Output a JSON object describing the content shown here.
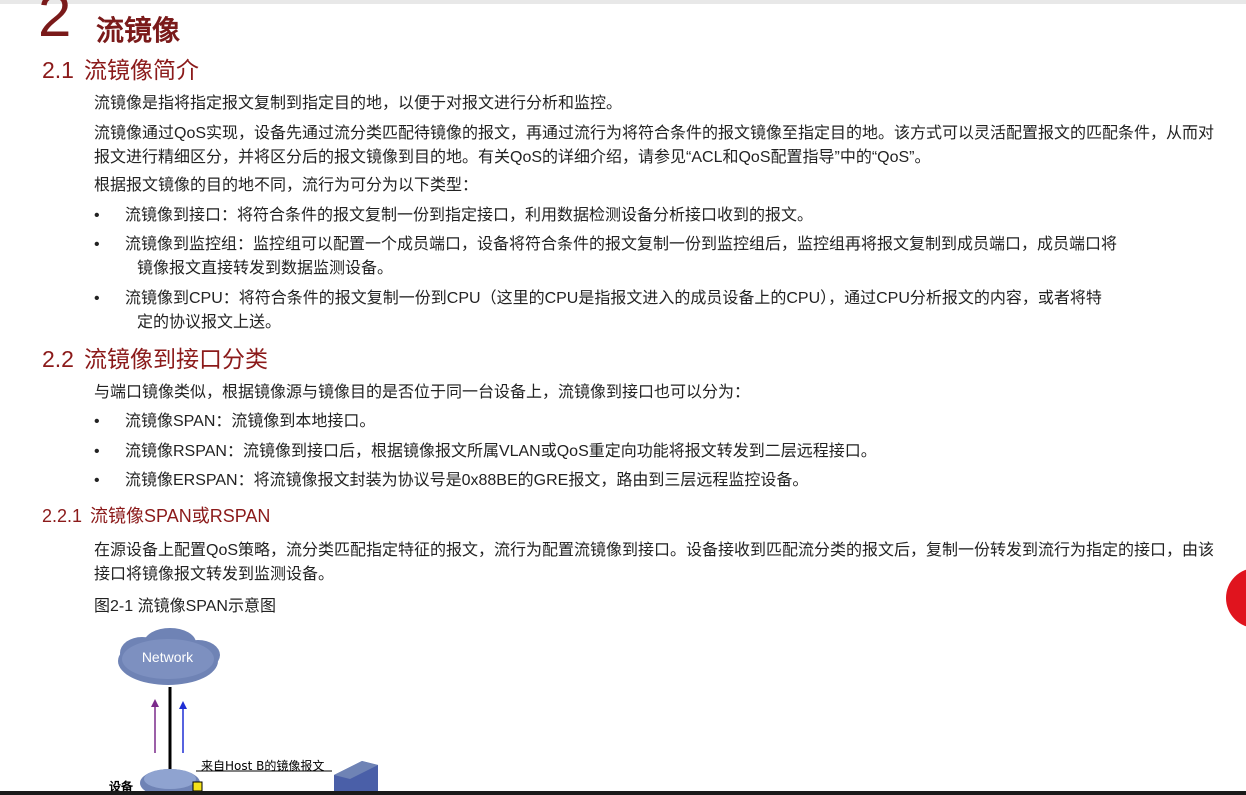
{
  "chapter": {
    "number": "2",
    "title": "流镜像"
  },
  "section_2_1": {
    "number": "2.1",
    "title": "流镜像简介",
    "para1": "流镜像是指将指定报文复制到指定目的地，以便于对报文进行分析和监控。",
    "para2": "流镜像通过QoS实现，设备先通过流分类匹配待镜像的报文，再通过流行为将符合条件的报文镜像至指定目的地。该方式可以灵活配置报文的匹配条件，从而对报文进行精细区分，并将区分后的报文镜像到目的地。有关QoS的详细介绍，请参见“ACL和QoS配置指导”中的“QoS”。",
    "para3": "根据报文镜像的目的地不同，流行为可分为以下类型：",
    "bullets": [
      {
        "line1": "流镜像到接口：将符合条件的报文复制一份到指定接口，利用数据检测设备分析接口收到的报文。",
        "line2": ""
      },
      {
        "line1": "流镜像到监控组：监控组可以配置一个成员端口，设备将符合条件的报文复制一份到监控组后，监控组再将报文复制到成员端口，成员端口将",
        "line2": "镜像报文直接转发到数据监测设备。"
      },
      {
        "line1": "流镜像到CPU：将符合条件的报文复制一份到CPU（这里的CPU是指报文进入的成员设备上的CPU），通过CPU分析报文的内容，或者将特",
        "line2": "定的协议报文上送。"
      }
    ]
  },
  "section_2_2": {
    "number": "2.2",
    "title": "流镜像到接口分类",
    "para1": "与端口镜像类似，根据镜像源与镜像目的是否位于同一台设备上，流镜像到接口也可以分为：",
    "bullets": [
      "流镜像SPAN：流镜像到本地接口。",
      "流镜像RSPAN：流镜像到接口后，根据镜像报文所属VLAN或QoS重定向功能将报文转发到二层远程接口。",
      "流镜像ERSPAN：将流镜像报文封装为协议号是0x88BE的GRE报文，路由到三层远程监控设备。"
    ]
  },
  "section_2_2_1": {
    "number": "2.2.1",
    "title": "流镜像SPAN或RSPAN",
    "para1": "在源设备上配置QoS策略，流分类匹配指定特征的报文，流行为配置流镜像到接口。设备接收到匹配流分类的报文后，复制一份转发到流行为指定的接口，由该接口将镜像报文转发到监测设备。",
    "figure_caption": "图2-1 流镜像SPAN示意图"
  },
  "diagram": {
    "network_label": "Network",
    "mirror_label": "来自Host B的镜像报文",
    "device_label": "设备",
    "cloud_color": "#6f83b5",
    "arrow_up_purple": "#7b2a8b",
    "arrow_up_blue": "#1f2fd4"
  },
  "colors": {
    "heading": "#8b1a1a",
    "badge": "#e0141e"
  }
}
